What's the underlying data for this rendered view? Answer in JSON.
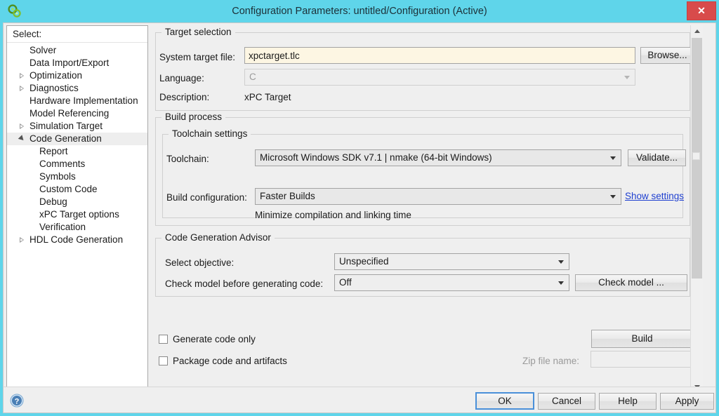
{
  "window": {
    "title": "Configuration Parameters: untitled/Configuration (Active)",
    "app_icon": "gears-icon",
    "close_label": "✕",
    "titlebar_color": "#5fd5ea",
    "close_color": "#d84b4b"
  },
  "sidebar": {
    "header": "Select:",
    "items": [
      {
        "label": "Solver",
        "level": 0,
        "arrow": "none",
        "selected": false
      },
      {
        "label": "Data Import/Export",
        "level": 0,
        "arrow": "none",
        "selected": false
      },
      {
        "label": "Optimization",
        "level": 0,
        "arrow": "collapsed",
        "selected": false
      },
      {
        "label": "Diagnostics",
        "level": 0,
        "arrow": "collapsed",
        "selected": false
      },
      {
        "label": "Hardware Implementation",
        "level": 0,
        "arrow": "none",
        "selected": false
      },
      {
        "label": "Model Referencing",
        "level": 0,
        "arrow": "none",
        "selected": false
      },
      {
        "label": "Simulation Target",
        "level": 0,
        "arrow": "collapsed",
        "selected": false
      },
      {
        "label": "Code Generation",
        "level": 0,
        "arrow": "expanded",
        "selected": true
      },
      {
        "label": "Report",
        "level": 1,
        "arrow": "none",
        "selected": false
      },
      {
        "label": "Comments",
        "level": 1,
        "arrow": "none",
        "selected": false
      },
      {
        "label": "Symbols",
        "level": 1,
        "arrow": "none",
        "selected": false
      },
      {
        "label": "Custom Code",
        "level": 1,
        "arrow": "none",
        "selected": false
      },
      {
        "label": "Debug",
        "level": 1,
        "arrow": "none",
        "selected": false
      },
      {
        "label": "xPC Target options",
        "level": 1,
        "arrow": "none",
        "selected": false
      },
      {
        "label": "Verification",
        "level": 1,
        "arrow": "none",
        "selected": false
      },
      {
        "label": "HDL Code Generation",
        "level": 0,
        "arrow": "collapsed",
        "selected": false
      }
    ]
  },
  "target_selection": {
    "group_title": "Target selection",
    "system_target_file_label": "System target file:",
    "system_target_file_value": "xpctarget.tlc",
    "browse_label": "Browse...",
    "language_label": "Language:",
    "language_value": "C",
    "description_label": "Description:",
    "description_value": "xPC Target"
  },
  "build_process": {
    "group_title": "Build process",
    "toolchain_group_title": "Toolchain settings",
    "toolchain_label": "Toolchain:",
    "toolchain_value": "Microsoft Windows SDK v7.1 | nmake (64-bit Windows)",
    "validate_label": "Validate...",
    "build_config_label": "Build configuration:",
    "build_config_value": "Faster Builds",
    "show_settings_label": "Show settings",
    "build_config_hint": "Minimize compilation and linking time"
  },
  "advisor": {
    "group_title": "Code Generation Advisor",
    "objective_label": "Select objective:",
    "objective_value": "Unspecified",
    "check_model_label": "Check model before generating code:",
    "check_model_value": "Off",
    "check_model_button": "Check model ..."
  },
  "actions": {
    "generate_code_only_label": "Generate code only",
    "generate_code_only_checked": false,
    "package_code_label": "Package code and artifacts",
    "package_code_checked": false,
    "build_label": "Build",
    "zip_file_name_label": "Zip file name:",
    "zip_file_name_value": ""
  },
  "footer": {
    "help_icon": "help-circle-icon",
    "ok_label": "OK",
    "cancel_label": "Cancel",
    "help_label": "Help",
    "apply_label": "Apply"
  },
  "scrollbar": {
    "up_arrow": "chevron-up-icon",
    "down_arrow": "chevron-down-icon"
  }
}
